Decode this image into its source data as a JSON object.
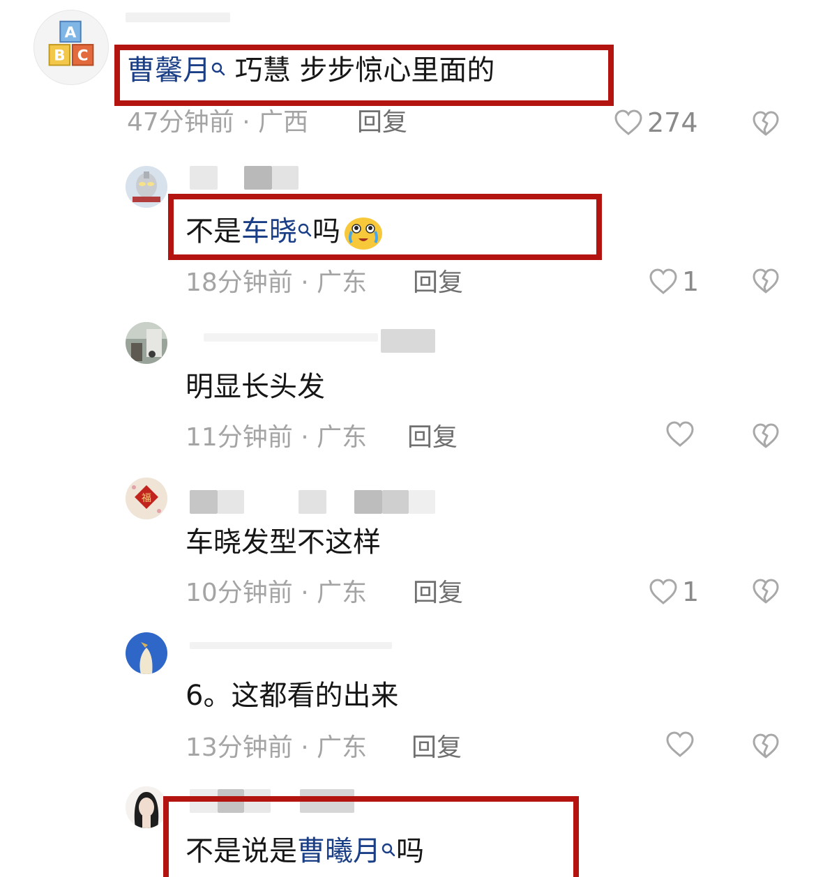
{
  "comments": [
    {
      "id": "c1",
      "link_name": "曹馨月",
      "text_after": " 巧慧 步步惊心里面的",
      "time": "47分钟前",
      "region": "广西",
      "reply_label": "回复",
      "likes": "274"
    },
    {
      "id": "c2",
      "text_before": "不是",
      "link_name": "车晓",
      "text_after": "吗",
      "emoji": "crying-laughing-emoji",
      "time": "18分钟前",
      "region": "广东",
      "reply_label": "回复",
      "likes": "1"
    },
    {
      "id": "c3",
      "text": "明显长头发",
      "time": "11分钟前",
      "region": "广东",
      "reply_label": "回复",
      "likes": ""
    },
    {
      "id": "c4",
      "text": "车晓发型不这样",
      "time": "10分钟前",
      "region": "广东",
      "reply_label": "回复",
      "likes": "1"
    },
    {
      "id": "c5",
      "text": "6。这都看的出来",
      "time": "13分钟前",
      "region": "广东",
      "reply_label": "回复",
      "likes": ""
    },
    {
      "id": "c6",
      "text_before": "不是说是",
      "link_name": "曹曦月",
      "text_after": "吗"
    }
  ],
  "separator": " · ",
  "colors": {
    "highlight_box": "#b3140f",
    "link": "#1b3f86",
    "meta": "#a4a4a4"
  },
  "icons": {
    "like": "heart-outline-icon",
    "dislike": "broken-heart-icon",
    "search": "search-icon"
  }
}
